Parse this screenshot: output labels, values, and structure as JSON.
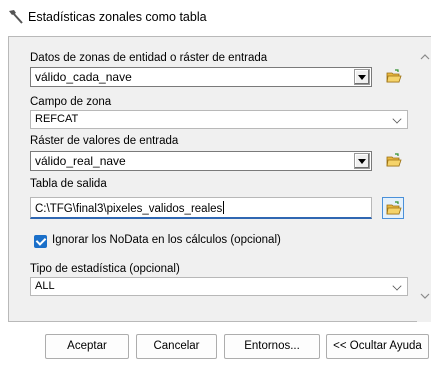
{
  "window": {
    "title": "Estadísticas zonales como tabla"
  },
  "fields": {
    "zone_input": {
      "label": "Datos de zonas de entidad o ráster de entrada",
      "value": "válido_cada_nave"
    },
    "zone_field": {
      "label": "Campo de zona",
      "value": "REFCAT"
    },
    "value_raster": {
      "label": "Ráster de valores de entrada",
      "value": "válido_real_nave"
    },
    "output_table": {
      "label": "Tabla de salida",
      "value": "C:\\TFG\\final3\\pixeles_validos_reales"
    },
    "ignore_nodata": {
      "label": "Ignorar los NoData en los cálculos (opcional)",
      "checked": true
    },
    "stat_type": {
      "label": "Tipo de estadística (opcional)",
      "value": "ALL"
    }
  },
  "buttons": {
    "ok": "Aceptar",
    "cancel": "Cancelar",
    "environments": "Entornos...",
    "hide_help": "<< Ocultar Ayuda"
  },
  "colors": {
    "accent": "#1a6fc9",
    "panel_bg": "#f0f0f0"
  }
}
